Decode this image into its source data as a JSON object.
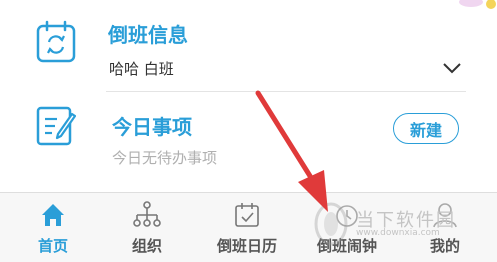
{
  "shift_info": {
    "title": "倒班信息",
    "value": "哈哈  白班"
  },
  "today": {
    "title": "今日事项",
    "empty_text": "今日无待办事项",
    "new_button": "新建"
  },
  "tabs": [
    {
      "label": "首页",
      "icon": "home-icon",
      "active": true
    },
    {
      "label": "组织",
      "icon": "org-tree-icon",
      "active": false
    },
    {
      "label": "倒班日历",
      "icon": "calendar-icon",
      "active": false
    },
    {
      "label": "倒班闹钟",
      "icon": "alarm-clock-icon",
      "active": false
    },
    {
      "label": "我的",
      "icon": "person-icon",
      "active": false
    }
  ],
  "watermark": {
    "text": "当下软件园",
    "url": "www.downxia.com"
  },
  "colors": {
    "accent": "#2a9ed8",
    "arrow": "#e03a3a",
    "tabbar_bg": "#f7f7f7"
  }
}
